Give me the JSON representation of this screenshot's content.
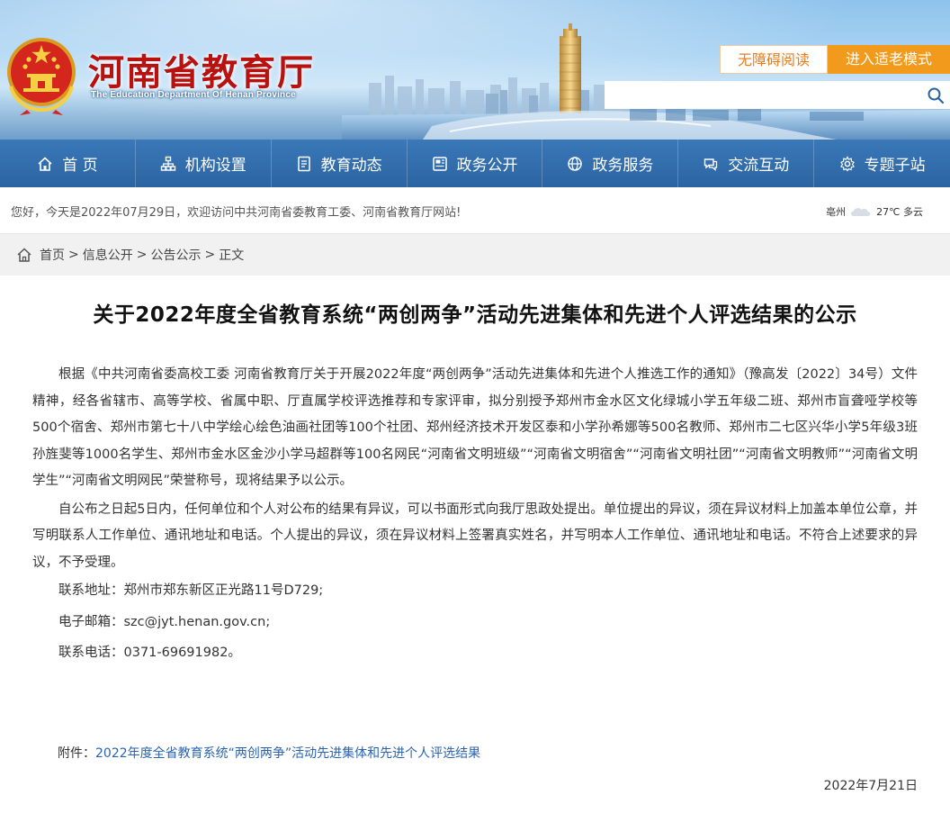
{
  "header": {
    "title": "河南省教育厅",
    "subtitle": "The Education Department Of Henan Province",
    "accessible_label": "无障碍阅读",
    "elder_mode_label": "进入适老模式",
    "search": {
      "value": "",
      "placeholder": ""
    }
  },
  "icons": {
    "emblem": "national-emblem",
    "search": "search-icon",
    "home": "home-icon",
    "org": "org-chart-icon",
    "news": "document-icon",
    "affairs": "newspaper-icon",
    "service": "globe-icon",
    "interact": "chat-icon",
    "topic": "settings-icon",
    "weather": "cloud-icon"
  },
  "nav": {
    "items": [
      {
        "label": "首 页"
      },
      {
        "label": "机构设置"
      },
      {
        "label": "教育动态"
      },
      {
        "label": "政务公开"
      },
      {
        "label": "政务服务"
      },
      {
        "label": "交流互动"
      },
      {
        "label": "专题子站"
      }
    ]
  },
  "welcome": {
    "text": "您好，今天是2022年07月29日，欢迎访问中共河南省委教育工委、河南省教育厅网站!",
    "weather_city": "亳州",
    "weather_temp": "27℃ 多云"
  },
  "breadcrumb": {
    "items": [
      "首页",
      "信息公开",
      "公告公示"
    ],
    "current": "正文",
    "separator": ">"
  },
  "article": {
    "title": "关于2022年度全省教育系统“两创两争”活动先进集体和先进个人评选结果的公示",
    "paragraphs": [
      "根据《中共河南省委高校工委 河南省教育厅关于开展2022年度“两创两争”活动先进集体和先进个人推选工作的通知》（豫高发〔2022〕34号）文件精神，经各省辖市、高等学校、省属中职、厅直属学校评选推荐和专家评审，拟分别授予郑州市金水区文化绿城小学五年级二班、郑州市盲聋哑学校等500个宿舍、郑州市第七十八中学绘心绘色油画社团等100个社团、郑州经济技术开发区泰和小学孙希娜等500名教师、郑州市二七区兴华小学5年级3班孙旌斐等1000名学生、郑州市金水区金沙小学马超群等100名网民“河南省文明班级”“河南省文明宿舍”“河南省文明社团”“河南省文明教师”“河南省文明学生”“河南省文明网民”荣誉称号，现将结果予以公示。",
      "自公布之日起5日内，任何单位和个人对公布的结果有异议，可以书面形式向我厅思政处提出。单位提出的异议，须在异议材料上加盖本单位公章，并写明联系人工作单位、通讯地址和电话。个人提出的异议，须在异议材料上签署真实姓名，并写明本人工作单位、通讯地址和电话。不符合上述要求的异议，不予受理。"
    ],
    "contacts": [
      "联系地址：郑州市郑东新区正光路11号D729;",
      "电子邮箱：szc@jyt.henan.gov.cn;",
      "联系电话：0371-69691982。"
    ],
    "attachment_label": "附件：",
    "attachment_link": "2022年度全省教育系统“两创两争”活动先进集体和先进个人评选结果",
    "date": "2022年7月21日"
  },
  "colors": {
    "brand_red": "#b7120f",
    "nav_blue": "#2c64a2",
    "elder_orange": "#f19a1b",
    "accessible_text": "#e87d1e",
    "link_blue": "#2a64b0"
  }
}
